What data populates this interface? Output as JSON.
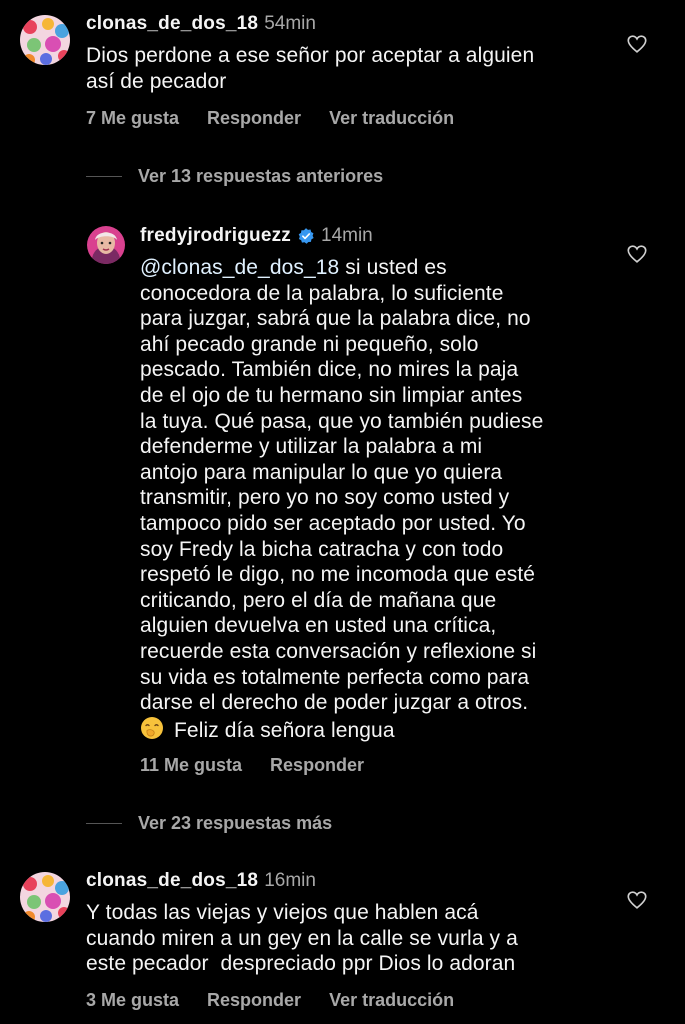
{
  "comments": [
    {
      "username": "clonas_de_dos_18",
      "time": "54min",
      "lines": [
        "Dios perdone a ese señor por aceptar a alguien",
        "así de pecador"
      ],
      "likes": "7 Me gusta",
      "reply": "Responder",
      "translate": "Ver traducción"
    },
    {
      "username": "fredyjrodriguezz",
      "verified": true,
      "time": "14min",
      "mention": "@clonas_de_dos_18",
      "first_line_rest": " si usted es",
      "lines": [
        "conocedora de la palabra, lo suficiente",
        "para juzgar, sabrá que la palabra dice, no",
        "ahí pecado grande ni pequeño, solo",
        "pescado. También dice, no mires la paja",
        "de el ojo de tu hermano sin limpiar antes",
        "la tuya. Qué pasa, que yo también pudiese",
        "defenderme y utilizar la palabra a mi",
        "antojo para manipular lo que yo quiera",
        "transmitir, pero yo no soy como usted y",
        "tampoco pido ser aceptado por usted. Yo",
        "soy Fredy la bicha catracha y con todo",
        "respetó le digo, no me incomoda que esté",
        "criticando, pero el día de mañana que",
        "alguien devuelva en usted una crítica,",
        "recuerde esta conversación y reflexione si",
        "su vida es totalmente perfecta como para",
        "darse el derecho de poder juzgar a otros."
      ],
      "last_line": "Feliz día señora lengua",
      "emoji_icon": "face-with-hand-over-mouth-icon",
      "likes": "11 Me gusta",
      "reply": "Responder"
    },
    {
      "username": "clonas_de_dos_18",
      "time": "16min",
      "lines": [
        "Y todas las viejas y viejos que hablen acá",
        "cuando miren a un gey en la calle se vurla y a",
        "este pecador  despreciado ppr Dios lo adoran"
      ],
      "likes": "3 Me gusta",
      "reply": "Responder",
      "translate": "Ver traducción"
    }
  ],
  "view_previous": "Ver 13 respuestas anteriores",
  "view_more": "Ver 23 respuestas más",
  "colors": {
    "background": "#000000",
    "text": "#f5f5f5",
    "muted": "#a8a8a8",
    "mention": "#e0f1ff",
    "verified": "#3797f0"
  }
}
